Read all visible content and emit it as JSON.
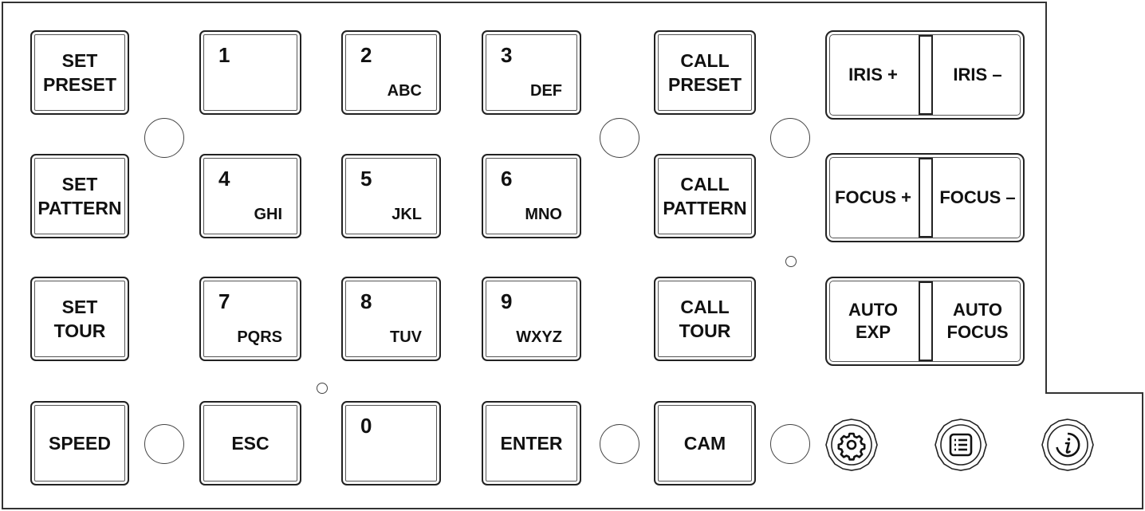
{
  "keypad": {
    "set_preset": "SET\nPRESET",
    "set_pattern": "SET\nPATTERN",
    "set_tour": "SET\nTOUR",
    "speed": "SPEED",
    "esc": "ESC",
    "enter": "ENTER",
    "call_preset": "CALL\nPRESET",
    "call_pattern": "CALL\nPATTERN",
    "call_tour": "CALL\nTOUR",
    "cam": "CAM",
    "digits": [
      {
        "num": "1",
        "letters": ""
      },
      {
        "num": "2",
        "letters": "ABC"
      },
      {
        "num": "3",
        "letters": "DEF"
      },
      {
        "num": "4",
        "letters": "GHI"
      },
      {
        "num": "5",
        "letters": "JKL"
      },
      {
        "num": "6",
        "letters": "MNO"
      },
      {
        "num": "7",
        "letters": "PQRS"
      },
      {
        "num": "8",
        "letters": "TUV"
      },
      {
        "num": "9",
        "letters": "WXYZ"
      },
      {
        "num": "0",
        "letters": ""
      }
    ]
  },
  "lens": {
    "iris_plus": "IRIS +",
    "iris_minus": "IRIS –",
    "focus_plus": "FOCUS +",
    "focus_minus": "FOCUS –",
    "auto_exp": "AUTO\nEXP",
    "auto_focus": "AUTO\nFOCUS"
  },
  "icons": {
    "settings": "gear-icon",
    "menu": "list-icon",
    "info": "info-icon"
  }
}
